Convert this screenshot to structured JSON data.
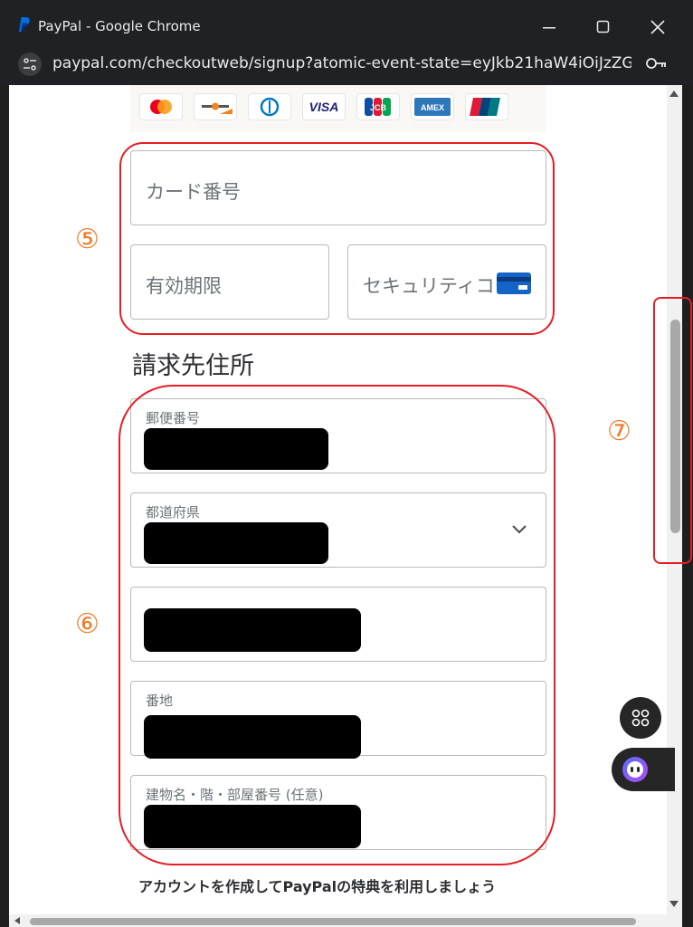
{
  "window": {
    "title": "PayPal - Google Chrome",
    "url": "paypal.com/checkoutweb/signup?atomic-event-state=eyJkb21haW4iOiJzZGtf..."
  },
  "card_logos": [
    "mastercard",
    "discover",
    "diners",
    "VISA",
    "JCB",
    "AMEX",
    "UnionPay"
  ],
  "card_form": {
    "card_number_placeholder": "カード番号",
    "expiry_placeholder": "有効期限",
    "security_code_placeholder": "セキュリティコード"
  },
  "billing": {
    "title": "請求先住所",
    "postal_label": "郵便番号",
    "prefecture_label": "都道府県",
    "street_label": "番地",
    "building_label": "建物名・階・部屋番号 (任意)"
  },
  "annotations": {
    "five": "⑤",
    "six": "⑥",
    "seven": "⑦"
  },
  "footer": {
    "text": "アカウントを作成してPayPalの特典を利用しましょう"
  },
  "colors": {
    "annotation_ring": "#e51e25",
    "annotation_number": "#f07a2a"
  }
}
